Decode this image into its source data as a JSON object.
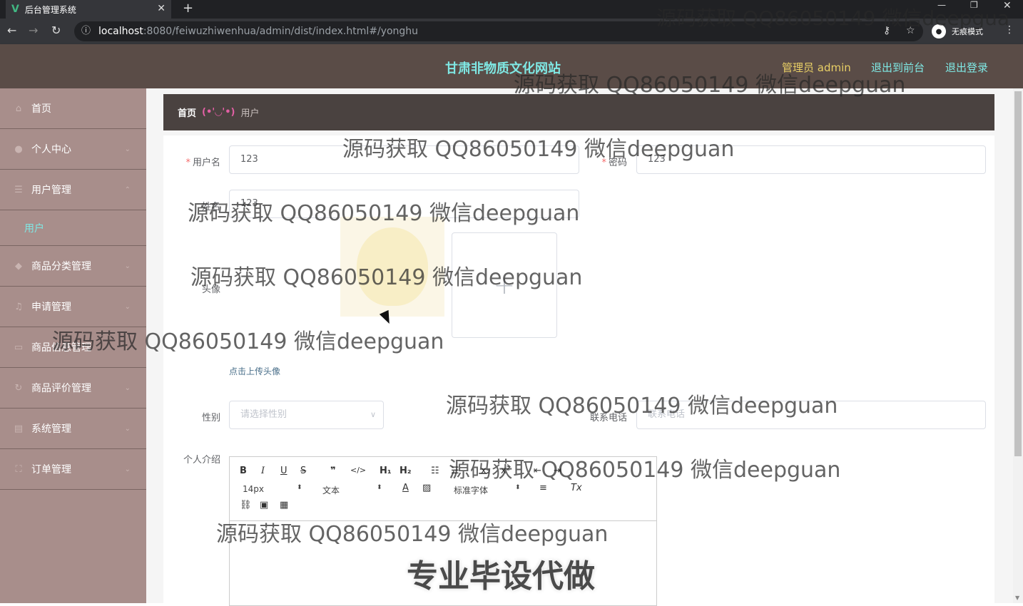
{
  "browser": {
    "tab_title": "后台管理系统",
    "url_host": "localhost",
    "url_path": ":8080/feiwuzhiwenhua/admin/dist/index.html#/yonghu",
    "incognito_label": "无痕模式"
  },
  "header": {
    "site_title": "甘肃非物质文化网站",
    "admin_label": "管理员 admin",
    "to_front": "退出到前台",
    "logout": "退出登录"
  },
  "sidebar": {
    "items": [
      {
        "label": "首页",
        "icon": "home-icon"
      },
      {
        "label": "个人中心",
        "icon": "user-icon"
      },
      {
        "label": "用户管理",
        "icon": "menu-icon"
      },
      {
        "label": "用户",
        "icon": ""
      },
      {
        "label": "商品分类管理",
        "icon": "tag-icon"
      },
      {
        "label": "申请管理",
        "icon": "mic-icon"
      },
      {
        "label": "商品信息管理",
        "icon": "card-icon"
      },
      {
        "label": "商品评价管理",
        "icon": "refresh-icon"
      },
      {
        "label": "系统管理",
        "icon": "calendar-icon"
      },
      {
        "label": "订单管理",
        "icon": "frame-icon"
      }
    ]
  },
  "breadcrumb": {
    "home": "首页",
    "separator": "(•'◡'•)",
    "current": "用户"
  },
  "form": {
    "username_label": "用户名",
    "username_value": "123",
    "password_label": "密码",
    "password_value": "123",
    "name_label": "姓名",
    "name_value": "123",
    "avatar_label": "头像",
    "upload_tip": "点击上传头像",
    "gender_label": "性别",
    "gender_placeholder": "请选择性别",
    "phone_label": "联系电话",
    "phone_placeholder": "联系电话",
    "intro_label": "个人介绍"
  },
  "editor": {
    "font_size": "14px",
    "block_type": "文本",
    "font_family": "标准字体"
  },
  "watermarks": {
    "text": "源码获取 QQ86050149 微信deepguan",
    "text_truncated": "源码获取 QQ86050149 微信deepgua",
    "big_text": "专业毕设代做"
  }
}
